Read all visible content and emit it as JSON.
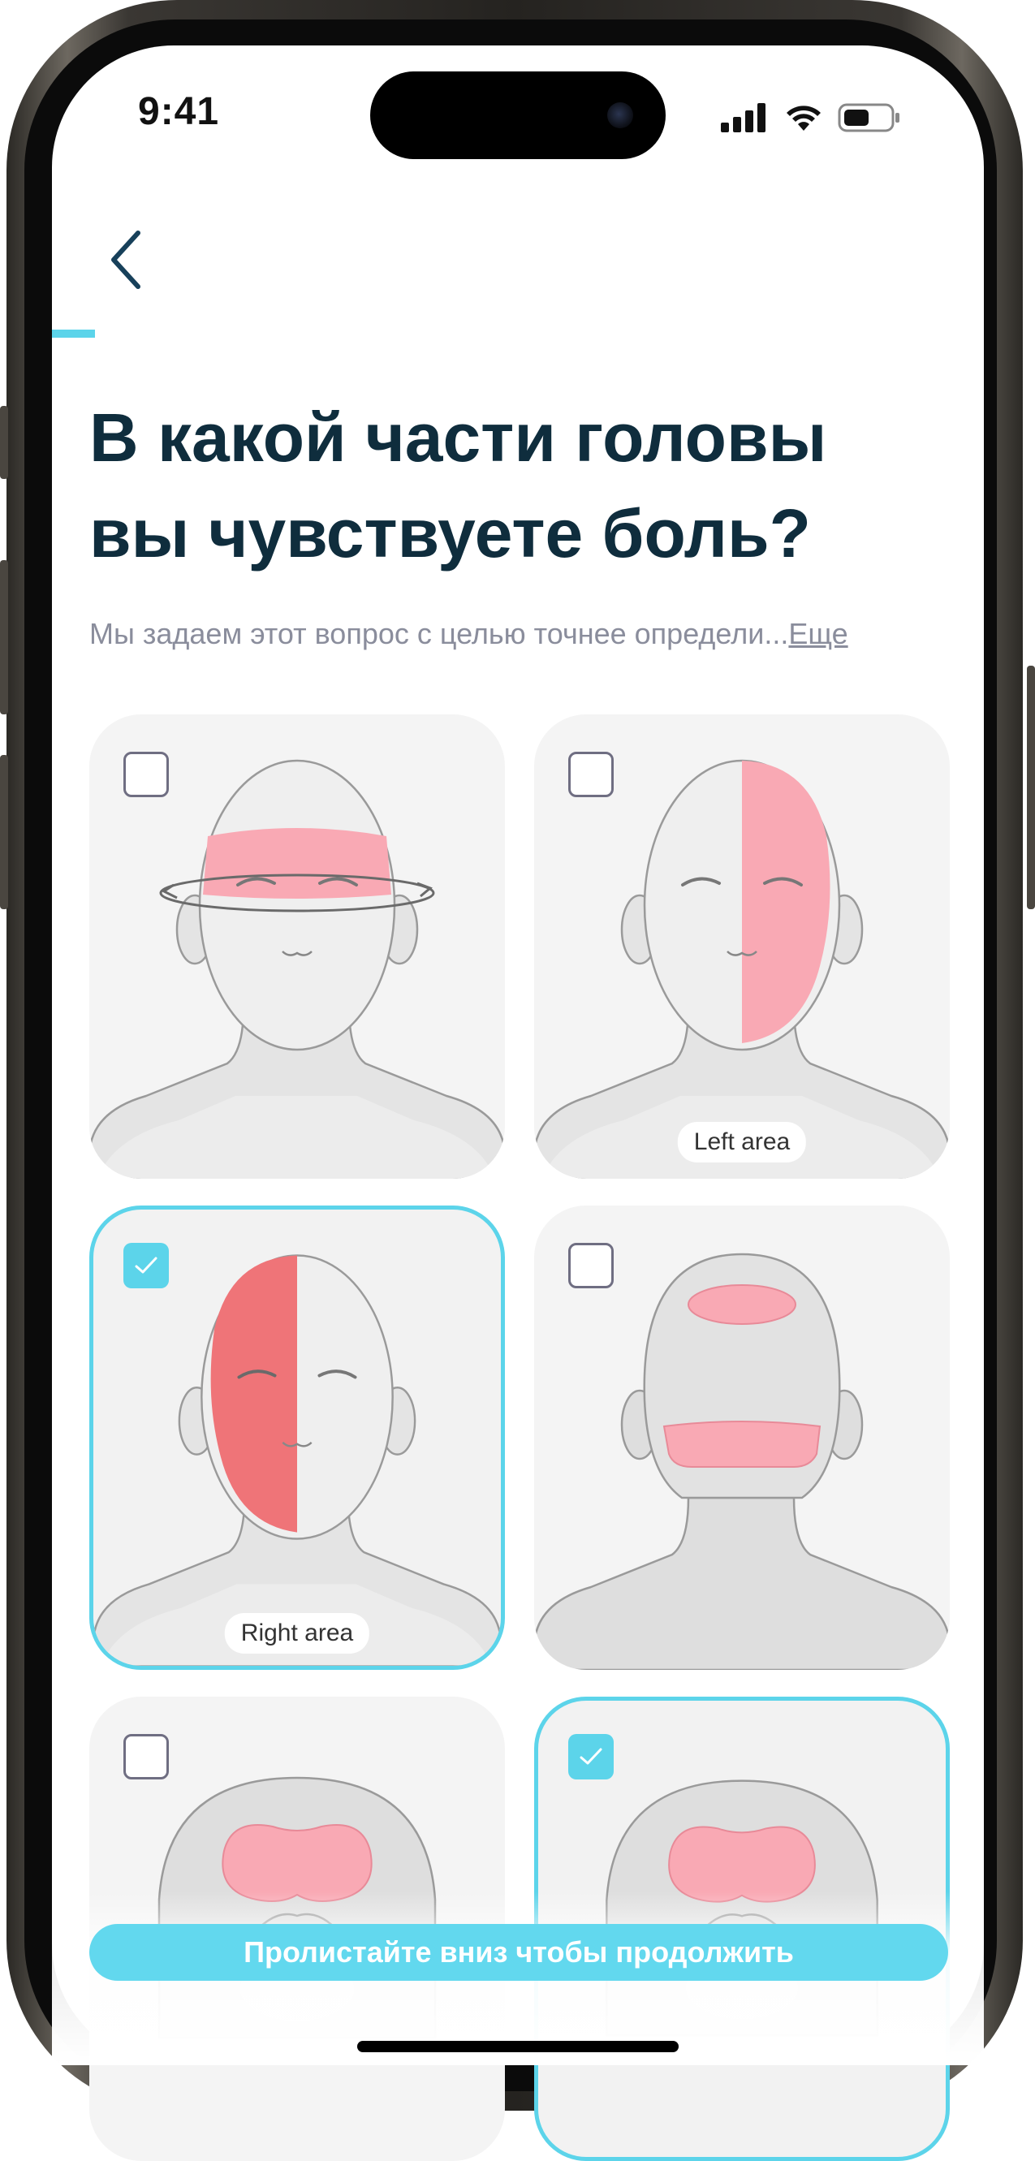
{
  "status_bar": {
    "time": "9:41"
  },
  "progress": {
    "fraction": 0.046
  },
  "question": {
    "title_line1": "В какой части головы",
    "title_line2": "вы чувствуете боль?",
    "subtitle": "Мы задаем этот вопрос с целью точнее определи...",
    "more_link": "Еще"
  },
  "options": [
    {
      "id": "around-head",
      "checked": false,
      "label": ""
    },
    {
      "id": "left-area",
      "checked": false,
      "label": "Left area"
    },
    {
      "id": "right-area",
      "checked": true,
      "label": "Right area"
    },
    {
      "id": "back-of-head",
      "checked": false,
      "label": ""
    },
    {
      "id": "top-of-head-1",
      "checked": false,
      "label": ""
    },
    {
      "id": "top-of-head-2",
      "checked": true,
      "label": ""
    }
  ],
  "cta": {
    "label": "Пролистайте вниз чтобы продолжить"
  },
  "colors": {
    "accent": "#5cd4ea",
    "title": "#0f2d3d",
    "subtitle": "#8a8d9c",
    "pain_light": "#f9a9b4",
    "pain_dark": "#ef7478"
  }
}
